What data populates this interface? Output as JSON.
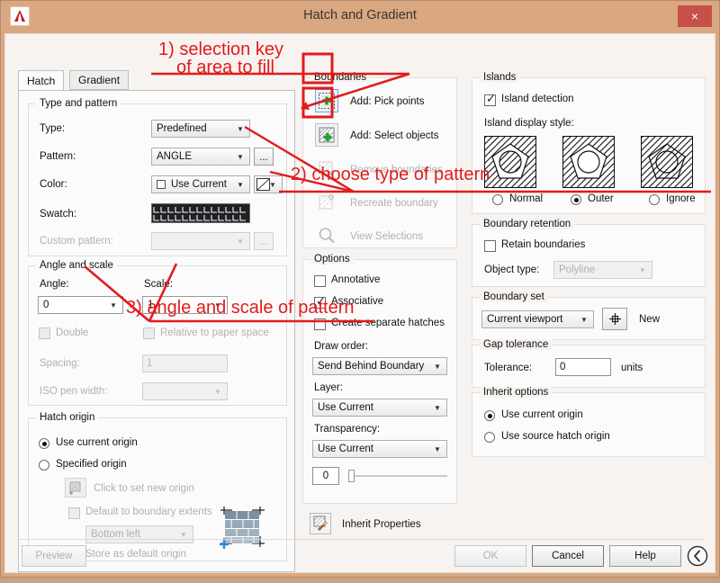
{
  "window": {
    "title": "Hatch and Gradient",
    "app_icon": "autocad-logo-icon",
    "close_label": "×"
  },
  "tabs": [
    {
      "label": "Hatch",
      "active": true
    },
    {
      "label": "Gradient",
      "active": false
    }
  ],
  "type_and_pattern": {
    "group_label": "Type and pattern",
    "type_label": "Type:",
    "type_value": "Predefined",
    "pattern_label": "Pattern:",
    "pattern_value": "ANGLE",
    "pattern_browse_label": "...",
    "color_label": "Color:",
    "color_value": "Use Current",
    "swatch_label": "Swatch:",
    "custom_pattern_label": "Custom pattern:",
    "custom_pattern_value": "",
    "custom_browse_label": "..."
  },
  "angle_and_scale": {
    "group_label": "Angle and scale",
    "angle_label": "Angle:",
    "angle_value": "0",
    "scale_label": "Scale:",
    "scale_value": "1",
    "double_label": "Double",
    "relative_label": "Relative to paper space",
    "spacing_label": "Spacing:",
    "spacing_value": "1",
    "iso_pen_label": "ISO pen width:",
    "iso_pen_value": ""
  },
  "hatch_origin": {
    "group_label": "Hatch origin",
    "use_current_label": "Use current origin",
    "use_current_selected": true,
    "specified_label": "Specified origin",
    "click_to_set_label": "Click to set new origin",
    "default_extents_label": "Default to boundary extents",
    "extents_value": "Bottom left",
    "store_default_label": "Store as default origin",
    "preview_icon": "brick-wall-origin-preview-icon"
  },
  "boundaries": {
    "group_label": "Boundaries",
    "items": [
      {
        "label": "Add: Pick points",
        "icon": "pick-points-icon",
        "enabled": true,
        "highlighted": true
      },
      {
        "label": "Add: Select objects",
        "icon": "select-objects-icon",
        "enabled": true,
        "highlighted": true
      },
      {
        "label": "Remove boundaries",
        "icon": "remove-boundaries-icon",
        "enabled": false,
        "highlighted": false
      },
      {
        "label": "Recreate boundary",
        "icon": "recreate-boundary-icon",
        "enabled": false,
        "highlighted": false
      },
      {
        "label": "View Selections",
        "icon": "magnifier-icon",
        "enabled": false,
        "highlighted": false
      }
    ]
  },
  "options": {
    "group_label": "Options",
    "annotative_label": "Annotative",
    "annotative_checked": false,
    "associative_label": "Associative",
    "associative_checked": true,
    "separate_hatches_label": "Create separate hatches",
    "separate_hatches_checked": false,
    "draw_order_label": "Draw order:",
    "draw_order_value": "Send Behind Boundary",
    "layer_label": "Layer:",
    "layer_value": "Use Current",
    "transparency_label": "Transparency:",
    "transparency_value": "Use Current",
    "transparency_number": "0"
  },
  "islands": {
    "group_label": "Islands",
    "detection_label": "Island detection",
    "detection_checked": true,
    "display_style_label": "Island display style:",
    "styles": [
      {
        "label": "Normal",
        "selected": false,
        "icon": "island-normal-icon"
      },
      {
        "label": "Outer",
        "selected": true,
        "icon": "island-outer-icon"
      },
      {
        "label": "Ignore",
        "selected": false,
        "icon": "island-ignore-icon"
      }
    ]
  },
  "boundary_retention": {
    "group_label": "Boundary retention",
    "retain_label": "Retain boundaries",
    "retain_checked": false,
    "object_type_label": "Object type:",
    "object_type_value": "Polyline"
  },
  "boundary_set": {
    "group_label": "Boundary set",
    "value": "Current viewport",
    "new_button_icon": "crosshair-pick-icon",
    "new_label": "New"
  },
  "gap_tolerance": {
    "group_label": "Gap tolerance",
    "tolerance_label": "Tolerance:",
    "tolerance_value": "0",
    "units_label": "units"
  },
  "inherit_options": {
    "group_label": "Inherit options",
    "use_current_label": "Use current origin",
    "use_current_selected": true,
    "use_source_label": "Use source hatch origin",
    "use_source_selected": false
  },
  "inherit_properties": {
    "label": "Inherit Properties",
    "icon": "inherit-properties-brush-icon"
  },
  "footer": {
    "preview_label": "Preview",
    "ok_label": "OK",
    "cancel_label": "Cancel",
    "help_label": "Help",
    "expand_icon": "chevron-left-circle-icon"
  },
  "annotations": [
    {
      "id": "note-1-line-1",
      "text": "1) selection key"
    },
    {
      "id": "note-1-line-2",
      "text": "of area to fill"
    },
    {
      "id": "note-2",
      "text": "2) choose type of pattern"
    },
    {
      "id": "note-3",
      "text": "3) angle and scale of pattern"
    }
  ],
  "colors": {
    "titlebar": "#d9a881",
    "close": "#c8504a",
    "annotation_red": "#e21b1b",
    "accent_select": "#7aa7d0"
  }
}
